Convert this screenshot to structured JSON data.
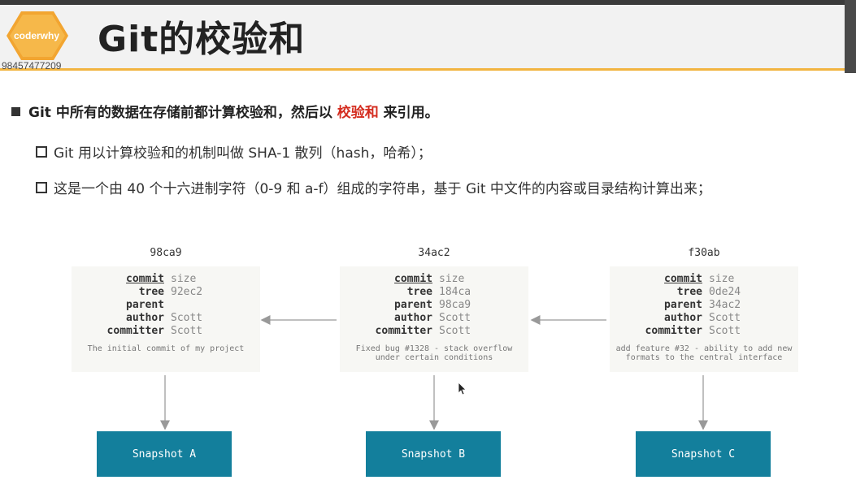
{
  "header": {
    "logo_text": "coderwhy",
    "user_id": "98457477209",
    "title": "Git的校验和"
  },
  "bullets": {
    "main_prefix": "Git 中所有的数据在存储前都计算校验和，然后以 ",
    "main_highlight": "校验和",
    "main_suffix": " 来引用。",
    "sub1": "Git 用以计算校验和的机制叫做 SHA-1 散列（hash，哈希）；",
    "sub2": "这是一个由 40 个十六进制字符（0-9 和 a-f）组成的字符串，基于 Git 中文件的内容或目录结构计算出来；"
  },
  "commits": [
    {
      "hash": "98ca9",
      "keys": [
        "commit",
        "tree",
        "parent",
        "author",
        "committer"
      ],
      "values": [
        "size",
        "92ec2",
        "",
        "Scott",
        "Scott"
      ],
      "message": [
        "The initial commit of my project"
      ],
      "snapshot": "Snapshot A"
    },
    {
      "hash": "34ac2",
      "keys": [
        "commit",
        "tree",
        "parent",
        "author",
        "committer"
      ],
      "values": [
        "size",
        "184ca",
        "98ca9",
        "Scott",
        "Scott"
      ],
      "message": [
        "Fixed bug #1328 - stack overflow",
        "under certain conditions"
      ],
      "snapshot": "Snapshot B"
    },
    {
      "hash": "f30ab",
      "keys": [
        "commit",
        "tree",
        "parent",
        "author",
        "committer"
      ],
      "values": [
        "size",
        "0de24",
        "34ac2",
        "Scott",
        "Scott"
      ],
      "message": [
        "add feature #32 - ability to add new",
        "formats to the central interface"
      ],
      "snapshot": "Snapshot C"
    }
  ],
  "colors": {
    "accent": "#f2b440",
    "highlight": "#d42b1e",
    "snapshot": "#137f9c"
  }
}
